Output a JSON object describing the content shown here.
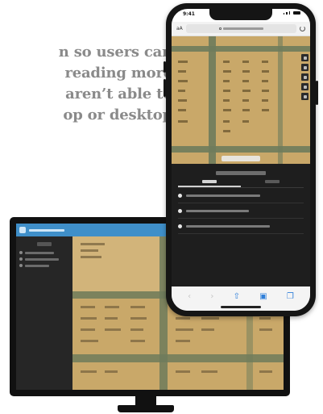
{
  "headline": {
    "lines": [
      "n so users can",
      "reading more",
      "aren’t able to",
      "op or desktop"
    ]
  },
  "phone": {
    "status_time": "9:41",
    "url": " ",
    "nav_icons": [
      "back-icon",
      "forward-icon",
      "share-icon",
      "bookmarks-icon",
      "tabs-icon"
    ]
  },
  "colors": {
    "document": "#c9a869",
    "topbar_blue": "#3f8fc9",
    "panel_dark": "#1e1e1e",
    "accent_blue": "#2f7fd9"
  }
}
